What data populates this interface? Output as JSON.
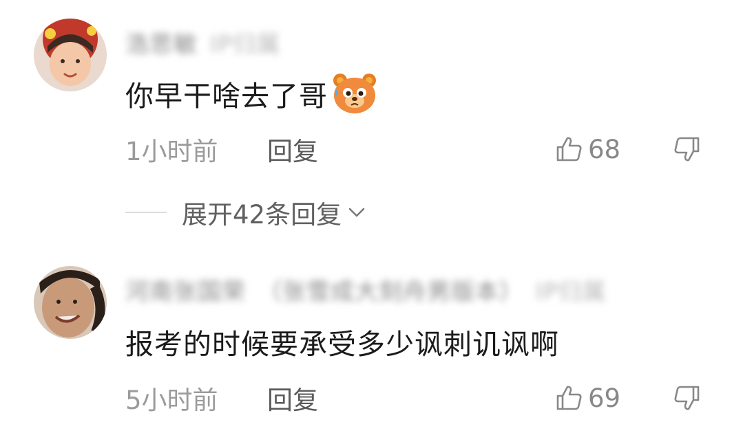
{
  "comments": [
    {
      "author": "浩思敏",
      "author_extra": "IP归属",
      "text": "你早干啥去了哥",
      "emoji": "bear-sweat-emoji",
      "time": "1小时前",
      "reply_label": "回复",
      "likes": "68",
      "expand_label": "展开42条回复"
    },
    {
      "author": "河南张国荣",
      "author_extra": "（张雪成大刻舟男版本）",
      "author_extra2": "IP归属",
      "text": "报考的时候要承受多少讽刺讥讽啊",
      "time": "5小时前",
      "reply_label": "回复",
      "likes": "69"
    }
  ],
  "icons": {
    "like": "thumbs-up-icon",
    "dislike": "thumbs-down-icon",
    "expand": "chevron-down-icon"
  },
  "colors": {
    "text": "#1b1b1b",
    "meta": "#9b9b9b",
    "reply": "#5a5a5a",
    "emoji": "#f08a3c"
  }
}
